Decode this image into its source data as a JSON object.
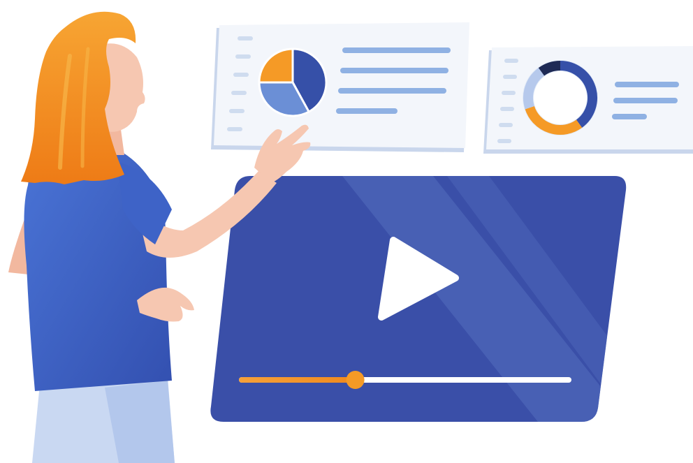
{
  "colors": {
    "panel": "#f3f6fb",
    "panel_shadow": "#c9d6ec",
    "line": "#8fb1e3",
    "tick": "#cfdcef",
    "navy": "#3650a8",
    "mid_blue": "#6b8fd6",
    "light_blue": "#b6c9ec",
    "orange": "#f59a26",
    "dark_navy": "#1e2a55",
    "screen": "#3a4fa8",
    "screen_stripe": "#5a74c2",
    "hair": "#f08a1e",
    "skin": "#f6c7b1",
    "shirt": "#3e63c7",
    "pants": "#c9d8f2"
  },
  "panel_1": {
    "chart_type": "pie",
    "slices": [
      {
        "value": 0.42,
        "color": "navy"
      },
      {
        "value": 0.33,
        "color": "mid_blue"
      },
      {
        "value": 0.25,
        "color": "orange"
      }
    ]
  },
  "panel_2": {
    "chart_type": "donut",
    "segments": [
      {
        "value": 0.4,
        "color": "navy"
      },
      {
        "value": 0.3,
        "color": "orange"
      },
      {
        "value": 0.2,
        "color": "light_blue"
      },
      {
        "value": 0.1,
        "color": "dark_navy"
      }
    ]
  },
  "video_player": {
    "progress": 0.35,
    "icons": [
      "play-icon"
    ]
  },
  "figure": {
    "description_icon": "woman-presenter"
  }
}
